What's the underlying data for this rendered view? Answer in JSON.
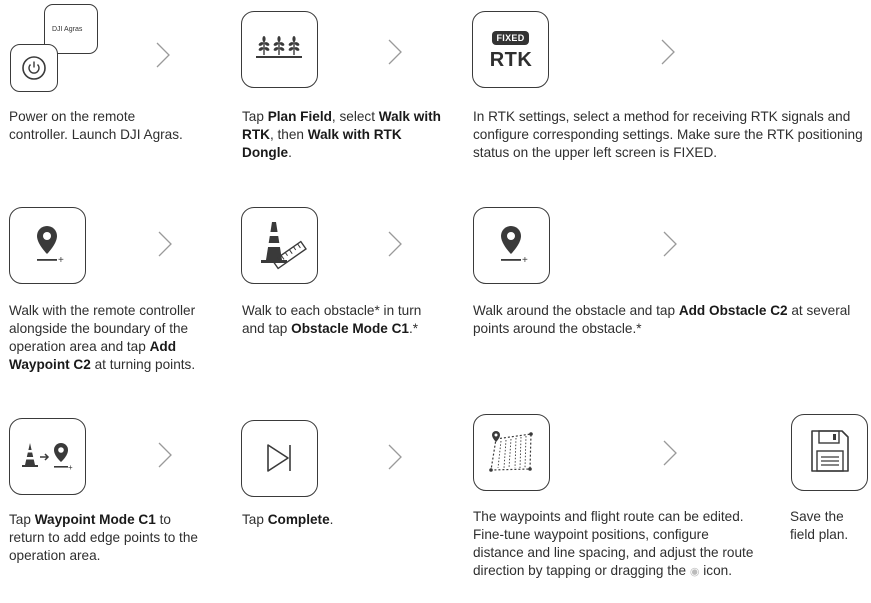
{
  "steps": [
    {
      "id": "power",
      "parts": [
        {
          "t": "Power on the remote controller. Launch DJI Agras."
        }
      ]
    },
    {
      "id": "plan",
      "parts": [
        {
          "t": "Tap "
        },
        {
          "t": "Plan Field",
          "b": true
        },
        {
          "t": ", select "
        },
        {
          "t": "Walk with RTK",
          "b": true
        },
        {
          "t": ", then "
        },
        {
          "t": "Walk with RTK Dongle",
          "b": true
        },
        {
          "t": "."
        }
      ]
    },
    {
      "id": "rtk",
      "parts": [
        {
          "t": "In RTK settings, select a method for receiving RTK signals and configure corresponding settings. Make sure the RTK positioning status on the upper left screen is FIXED."
        }
      ]
    },
    {
      "id": "walk",
      "parts": [
        {
          "t": "Walk with the remote controller alongside the boundary of the operation area and tap "
        },
        {
          "t": "Add Waypoint C2",
          "b": true
        },
        {
          "t": " at turning points."
        }
      ]
    },
    {
      "id": "obstacle",
      "parts": [
        {
          "t": "Walk to each obstacle* in turn and tap "
        },
        {
          "t": "Obstacle Mode C1",
          "b": true
        },
        {
          "t": ".*"
        }
      ]
    },
    {
      "id": "around",
      "parts": [
        {
          "t": "Walk around the obstacle and tap "
        },
        {
          "t": "Add Obstacle C2",
          "b": true
        },
        {
          "t": " at several points around the obstacle.*"
        }
      ]
    },
    {
      "id": "waypoint",
      "parts": [
        {
          "t": "Tap "
        },
        {
          "t": "Waypoint Mode C1",
          "b": true
        },
        {
          "t": " to return to add edge points to the operation area."
        }
      ]
    },
    {
      "id": "complete",
      "parts": [
        {
          "t": "Tap "
        },
        {
          "t": "Complete",
          "b": true
        },
        {
          "t": "."
        }
      ]
    },
    {
      "id": "edit",
      "parts": [
        {
          "t": "The waypoints and flight route can be edited. Fine-tune waypoint positions, configure distance and line spacing, and adjust the route direction by tapping or dragging the "
        },
        {
          "t": "◉",
          "icon": true
        },
        {
          "t": " icon."
        }
      ]
    },
    {
      "id": "save",
      "parts": [
        {
          "t": "Save the field plan."
        }
      ]
    }
  ],
  "icon_labels": {
    "dji_agras": "DJI Agras",
    "fixed_badge": "FIXED",
    "rtk": "RTK"
  },
  "icons": {
    "power": "power-icon",
    "plan": "crop-field-icon",
    "rtk": "rtk-fixed-icon",
    "walk": "waypoint-pin-add-icon",
    "obstacle": "traffic-cone-ruler-icon",
    "around": "waypoint-pin-add-icon",
    "waypoint": "cone-to-pin-icon",
    "complete": "skip-end-icon",
    "edit": "field-route-grid-icon",
    "save": "floppy-disk-icon"
  }
}
